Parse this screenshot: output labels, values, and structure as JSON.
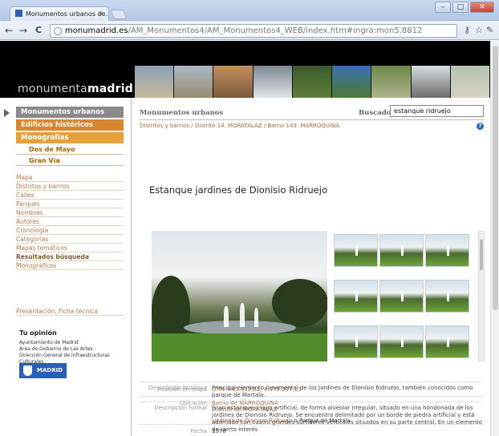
{
  "browser": {
    "tab_title": "Monumentos urbanos de...",
    "tab_close": "×",
    "url_domain": "monumadrid.es",
    "url_path": "/AM_Monumentos4/AM_Monumentos4_WEB/index.htm#ingra:mon5.8812",
    "back": "←",
    "forward": "→",
    "reload": "C",
    "win_min": "–",
    "win_max": "□",
    "win_close": "✕",
    "star": "☆",
    "wrench": "✎",
    "key": "⚷"
  },
  "site": {
    "logo_light": "monumenta",
    "logo_bold": "madrid"
  },
  "sidebar": {
    "main_nav": [
      {
        "label": "Monumentos urbanos",
        "color": "#8a8a8a"
      },
      {
        "label": "Edificios históricos",
        "color": "#d8862f"
      },
      {
        "label": "Monografías",
        "color": "#e2a13a"
      }
    ],
    "sub_items": [
      "Dos de Mayo",
      "Gran Vía"
    ],
    "links": [
      {
        "label": "Mapa",
        "bold": false
      },
      {
        "label": "Distritos y barrios",
        "bold": false
      },
      {
        "label": "Calles",
        "bold": false
      },
      {
        "label": "Parques",
        "bold": false
      },
      {
        "label": "Nombres",
        "bold": false
      },
      {
        "label": "Autores",
        "bold": false
      },
      {
        "label": "Cronología",
        "bold": false
      },
      {
        "label": "Categorías",
        "bold": false
      },
      {
        "label": "Mapas temáticos",
        "bold": false
      },
      {
        "label": "Resultados búsqueda",
        "bold": true
      },
      {
        "label": "Monográficos",
        "bold": false
      }
    ],
    "presentation_link": "Presentación, Ficha técnica",
    "opinion_title": "Tu opinión",
    "credits": [
      "Ayuntamiento de Madrid",
      "Área de Gobierno de Las Artes",
      "Dirección General de Infraestructuras Culturales"
    ],
    "badge_label": "MADRID"
  },
  "main": {
    "section_title": "Monumentos urbanos",
    "search_label": "Buscador",
    "search_value": "estanque ridruejo",
    "breadcrumb": "Distritos y barrios / Distrito 14. MORATALAZ / Barrio 143. MARROQUINA",
    "help": "?",
    "title": "Estanque jardines de Dionisio Ridruejo",
    "info": {
      "position_label": "Posición en mapa",
      "position_value": "UTM: 445.913,62; 4.473.397,13",
      "location_label": "Ubicación",
      "location_barrio": "Barrio de MARROQUINA",
      "location_distrito": "Distrito de MORATALAZ",
      "location_link": "Jardines de Dionisio Ridruejo",
      "location_sep": " o ",
      "location_park": "Parque de Martala",
      "date_label": "Fecha",
      "date_value": "1978",
      "hist_label": "Descripción histórica",
      "hist_value": "Principal elemento ornamental de los Jardines de Dionisio Ridruejo, también conocidos como parque de Martala.",
      "formal_label": "Descripción formal",
      "formal_value": "Gran estanque o lago artificial, de forma alveolar irregular, situado en una hondonada de los jardines de Dionisio Ridruejo. Se encuentra delimitado por un borde de piedra artificial y está adornado con cuatro grandes surtidores verticales situados en su parte central. En un elemento de cierto interés"
    }
  }
}
